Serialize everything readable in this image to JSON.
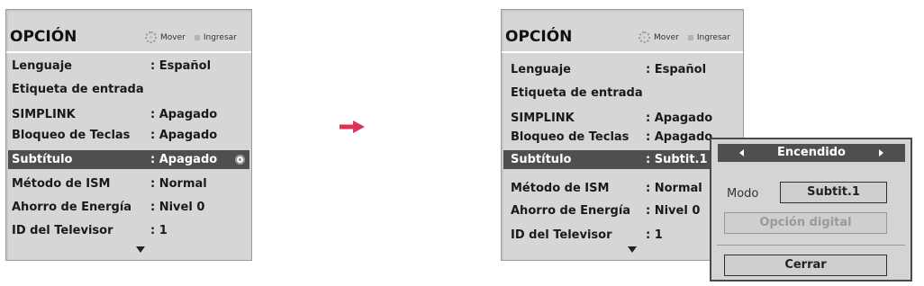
{
  "menu": {
    "title": "OPCIÓN",
    "hint_move": "Mover",
    "hint_enter": "Ingresar",
    "items": [
      {
        "label": "Lenguaje",
        "value": ": Español"
      },
      {
        "label": "Etiqueta de entrada",
        "value": ""
      },
      {
        "label": "SIMPLINK",
        "value": ": Apagado"
      },
      {
        "label": "Bloqueo de Teclas",
        "value": ": Apagado"
      },
      {
        "label": "Subtítulo",
        "value": ": Apagado"
      },
      {
        "label": "Método de ISM",
        "value": ": Normal"
      },
      {
        "label": "Ahorro de Energía",
        "value": ": Nivel 0"
      },
      {
        "label": "ID del Televisor",
        "value": ": 1"
      }
    ]
  },
  "menu2": {
    "title": "OPCIÓN",
    "hint_move": "Mover",
    "hint_enter": "Ingresar",
    "items": [
      {
        "label": "Lenguaje",
        "value": ": Español"
      },
      {
        "label": "Etiqueta de entrada",
        "value": ""
      },
      {
        "label": "SIMPLINK",
        "value": ": Apagado"
      },
      {
        "label": "Bloqueo de Teclas",
        "value": ": Apagado"
      },
      {
        "label": "Subtítulo",
        "value": ": Subtit.1"
      },
      {
        "label": "Método de ISM",
        "value": ": Normal"
      },
      {
        "label": "Ahorro de Energía",
        "value": ": Nivel 0"
      },
      {
        "label": "ID del Televisor",
        "value": ": 1"
      }
    ]
  },
  "popup": {
    "toggle_value": "Encendido",
    "mode_label": "Modo",
    "mode_value": "Subtit.1",
    "digital_option": "Opción digital",
    "close_label": "Cerrar"
  },
  "colors": {
    "panel_bg": "#d6d6d6",
    "selected_bg": "#4f4f4f",
    "arrow": "#e0305a"
  },
  "icons": [
    "move-icon",
    "enter-icon",
    "select-indicator-icon",
    "scroll-down-icon",
    "right-arrow-icon",
    "left-triangle-icon",
    "right-triangle-icon"
  ]
}
